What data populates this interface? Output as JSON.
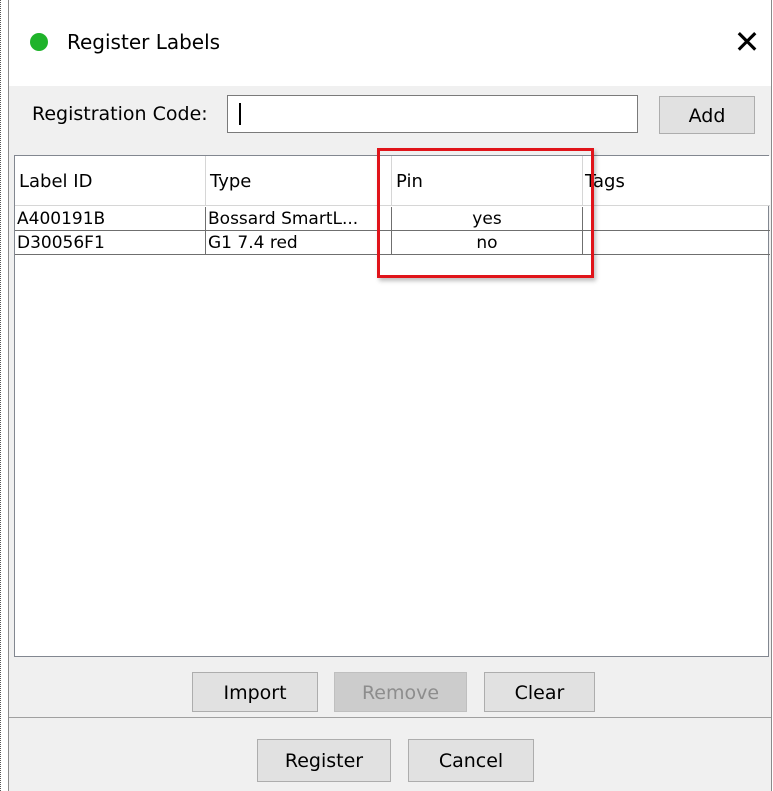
{
  "window": {
    "title": "Register Labels",
    "status_color": "#1fb32a",
    "close_label": "✕"
  },
  "registration": {
    "label": "Registration Code:",
    "value": "",
    "add_label": "Add"
  },
  "table": {
    "columns": [
      "Label ID",
      "Type",
      "Pin",
      "Tags"
    ],
    "rows": [
      {
        "label_id": "A400191B",
        "type": "Bossard SmartL...",
        "pin": "yes",
        "tags": ""
      },
      {
        "label_id": "D30056F1",
        "type": "G1 7.4 red",
        "pin": "no",
        "tags": ""
      }
    ]
  },
  "annotation": {
    "color": "#e0141a"
  },
  "actions": {
    "import_label": "Import",
    "remove_label": "Remove",
    "clear_label": "Clear"
  },
  "footer": {
    "register_label": "Register",
    "cancel_label": "Cancel"
  }
}
